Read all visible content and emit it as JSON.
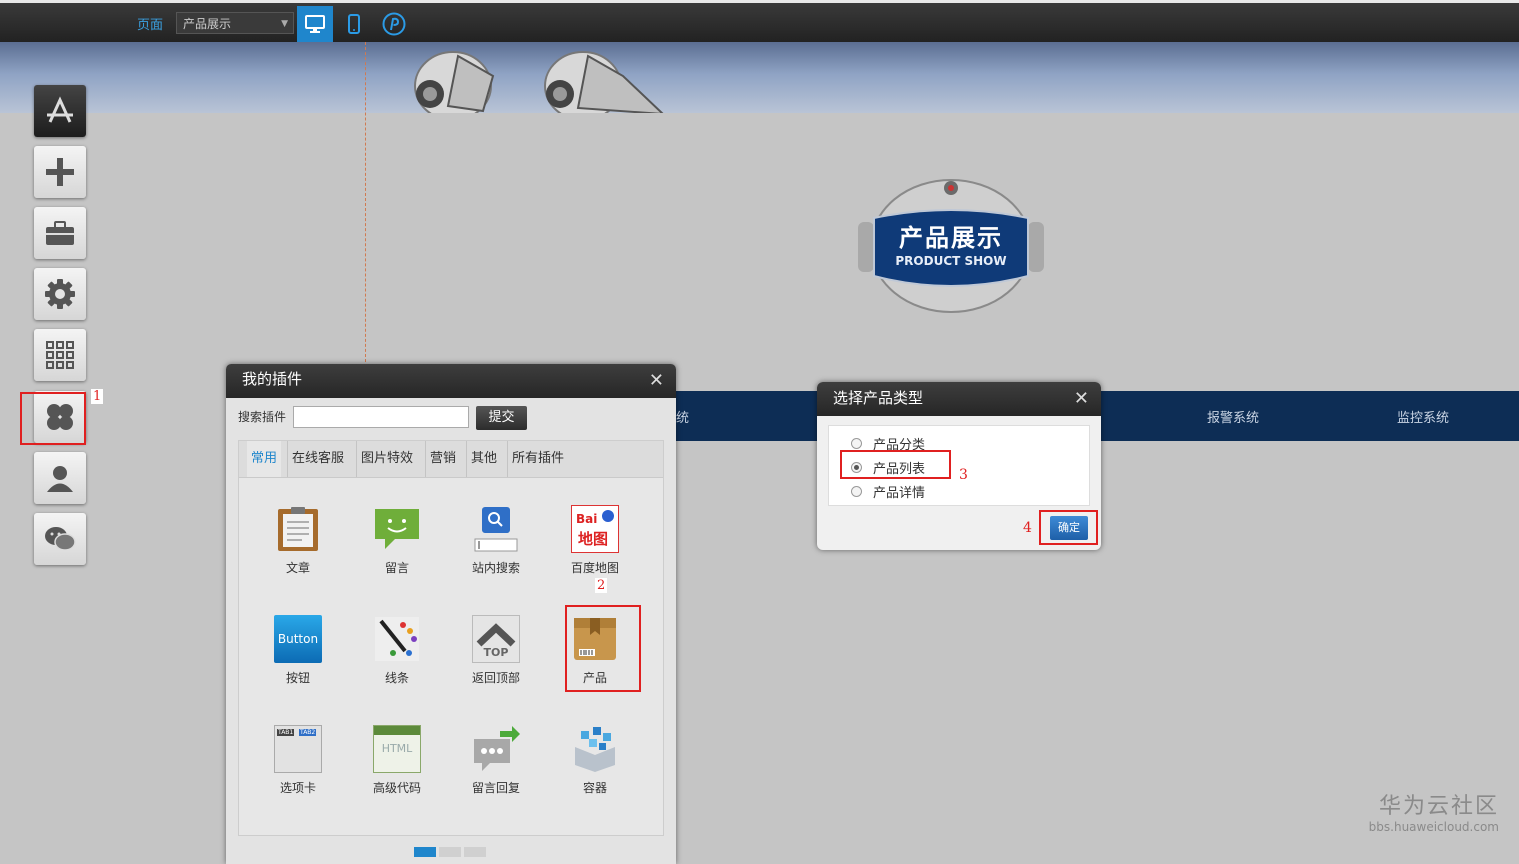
{
  "toolbar": {
    "page_label": "页面",
    "page_select_value": "产品展示",
    "buttons": [
      "desktop-view",
      "mobile-view",
      "preview"
    ]
  },
  "badge": {
    "title": "产品展示",
    "subtitle": "PRODUCT SHOW"
  },
  "navbar": {
    "items": [
      "统",
      "报警系统",
      "监控系统"
    ]
  },
  "sidebar": {
    "icons": [
      "app-store-icon",
      "plus-icon",
      "toolbox-icon",
      "gear-icon",
      "grid-icon",
      "plugin-clover-icon",
      "user-icon",
      "wechat-icon"
    ]
  },
  "annotations": {
    "step1": "1",
    "step2": "2",
    "step3": "3",
    "step4": "4"
  },
  "plugins_panel": {
    "title": "我的插件",
    "search_label": "搜索插件",
    "submit_label": "提交",
    "tabs": [
      "常用",
      "在线客服",
      "图片特效",
      "营销",
      "其他",
      "所有插件"
    ],
    "active_tab": "常用",
    "items": [
      {
        "label": "文章",
        "icon": "article-icon"
      },
      {
        "label": "留言",
        "icon": "message-icon"
      },
      {
        "label": "站内搜索",
        "icon": "site-search-icon"
      },
      {
        "label": "百度地图",
        "icon": "baidu-map-icon",
        "icon_text_1": "Bai",
        "icon_text_2": "地图"
      },
      {
        "label": "按钮",
        "icon": "button-icon",
        "icon_text": "Button"
      },
      {
        "label": "线条",
        "icon": "line-icon"
      },
      {
        "label": "返回顶部",
        "icon": "back-to-top-icon",
        "icon_text": "TOP"
      },
      {
        "label": "产品",
        "icon": "product-box-icon"
      },
      {
        "label": "选项卡",
        "icon": "tabs-icon",
        "icon_text_1": "TAB1",
        "icon_text_2": "TAB2"
      },
      {
        "label": "高级代码",
        "icon": "html-code-icon",
        "icon_text": "HTML"
      },
      {
        "label": "留言回复",
        "icon": "message-reply-icon"
      },
      {
        "label": "容器",
        "icon": "container-icon"
      }
    ]
  },
  "dialog": {
    "title": "选择产品类型",
    "options": [
      {
        "label": "产品分类",
        "checked": false
      },
      {
        "label": "产品列表",
        "checked": true
      },
      {
        "label": "产品详情",
        "checked": false
      }
    ],
    "ok_label": "确定"
  },
  "watermark": {
    "line1": "华为云社区",
    "line2": "bbs.huaweicloud.com"
  },
  "colors": {
    "accent": "#1f86cc",
    "highlight": "#e02020",
    "navbar": "#0d2d55"
  }
}
